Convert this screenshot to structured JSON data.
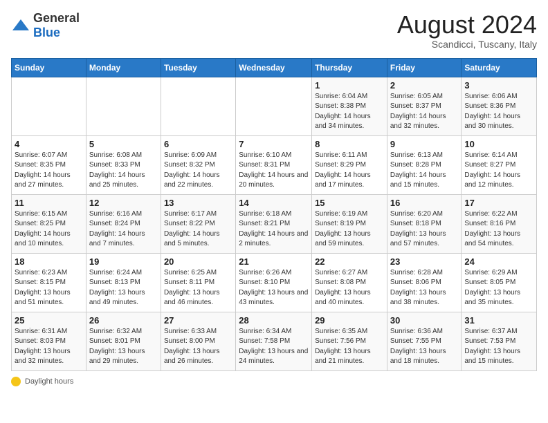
{
  "header": {
    "logo_general": "General",
    "logo_blue": "Blue",
    "month_year": "August 2024",
    "location": "Scandicci, Tuscany, Italy"
  },
  "days_of_week": [
    "Sunday",
    "Monday",
    "Tuesday",
    "Wednesday",
    "Thursday",
    "Friday",
    "Saturday"
  ],
  "weeks": [
    [
      {
        "day": "",
        "content": ""
      },
      {
        "day": "",
        "content": ""
      },
      {
        "day": "",
        "content": ""
      },
      {
        "day": "",
        "content": ""
      },
      {
        "day": "1",
        "content": "Sunrise: 6:04 AM\nSunset: 8:38 PM\nDaylight: 14 hours and 34 minutes."
      },
      {
        "day": "2",
        "content": "Sunrise: 6:05 AM\nSunset: 8:37 PM\nDaylight: 14 hours and 32 minutes."
      },
      {
        "day": "3",
        "content": "Sunrise: 6:06 AM\nSunset: 8:36 PM\nDaylight: 14 hours and 30 minutes."
      }
    ],
    [
      {
        "day": "4",
        "content": "Sunrise: 6:07 AM\nSunset: 8:35 PM\nDaylight: 14 hours and 27 minutes."
      },
      {
        "day": "5",
        "content": "Sunrise: 6:08 AM\nSunset: 8:33 PM\nDaylight: 14 hours and 25 minutes."
      },
      {
        "day": "6",
        "content": "Sunrise: 6:09 AM\nSunset: 8:32 PM\nDaylight: 14 hours and 22 minutes."
      },
      {
        "day": "7",
        "content": "Sunrise: 6:10 AM\nSunset: 8:31 PM\nDaylight: 14 hours and 20 minutes."
      },
      {
        "day": "8",
        "content": "Sunrise: 6:11 AM\nSunset: 8:29 PM\nDaylight: 14 hours and 17 minutes."
      },
      {
        "day": "9",
        "content": "Sunrise: 6:13 AM\nSunset: 8:28 PM\nDaylight: 14 hours and 15 minutes."
      },
      {
        "day": "10",
        "content": "Sunrise: 6:14 AM\nSunset: 8:27 PM\nDaylight: 14 hours and 12 minutes."
      }
    ],
    [
      {
        "day": "11",
        "content": "Sunrise: 6:15 AM\nSunset: 8:25 PM\nDaylight: 14 hours and 10 minutes."
      },
      {
        "day": "12",
        "content": "Sunrise: 6:16 AM\nSunset: 8:24 PM\nDaylight: 14 hours and 7 minutes."
      },
      {
        "day": "13",
        "content": "Sunrise: 6:17 AM\nSunset: 8:22 PM\nDaylight: 14 hours and 5 minutes."
      },
      {
        "day": "14",
        "content": "Sunrise: 6:18 AM\nSunset: 8:21 PM\nDaylight: 14 hours and 2 minutes."
      },
      {
        "day": "15",
        "content": "Sunrise: 6:19 AM\nSunset: 8:19 PM\nDaylight: 13 hours and 59 minutes."
      },
      {
        "day": "16",
        "content": "Sunrise: 6:20 AM\nSunset: 8:18 PM\nDaylight: 13 hours and 57 minutes."
      },
      {
        "day": "17",
        "content": "Sunrise: 6:22 AM\nSunset: 8:16 PM\nDaylight: 13 hours and 54 minutes."
      }
    ],
    [
      {
        "day": "18",
        "content": "Sunrise: 6:23 AM\nSunset: 8:15 PM\nDaylight: 13 hours and 51 minutes."
      },
      {
        "day": "19",
        "content": "Sunrise: 6:24 AM\nSunset: 8:13 PM\nDaylight: 13 hours and 49 minutes."
      },
      {
        "day": "20",
        "content": "Sunrise: 6:25 AM\nSunset: 8:11 PM\nDaylight: 13 hours and 46 minutes."
      },
      {
        "day": "21",
        "content": "Sunrise: 6:26 AM\nSunset: 8:10 PM\nDaylight: 13 hours and 43 minutes."
      },
      {
        "day": "22",
        "content": "Sunrise: 6:27 AM\nSunset: 8:08 PM\nDaylight: 13 hours and 40 minutes."
      },
      {
        "day": "23",
        "content": "Sunrise: 6:28 AM\nSunset: 8:06 PM\nDaylight: 13 hours and 38 minutes."
      },
      {
        "day": "24",
        "content": "Sunrise: 6:29 AM\nSunset: 8:05 PM\nDaylight: 13 hours and 35 minutes."
      }
    ],
    [
      {
        "day": "25",
        "content": "Sunrise: 6:31 AM\nSunset: 8:03 PM\nDaylight: 13 hours and 32 minutes."
      },
      {
        "day": "26",
        "content": "Sunrise: 6:32 AM\nSunset: 8:01 PM\nDaylight: 13 hours and 29 minutes."
      },
      {
        "day": "27",
        "content": "Sunrise: 6:33 AM\nSunset: 8:00 PM\nDaylight: 13 hours and 26 minutes."
      },
      {
        "day": "28",
        "content": "Sunrise: 6:34 AM\nSunset: 7:58 PM\nDaylight: 13 hours and 24 minutes."
      },
      {
        "day": "29",
        "content": "Sunrise: 6:35 AM\nSunset: 7:56 PM\nDaylight: 13 hours and 21 minutes."
      },
      {
        "day": "30",
        "content": "Sunrise: 6:36 AM\nSunset: 7:55 PM\nDaylight: 13 hours and 18 minutes."
      },
      {
        "day": "31",
        "content": "Sunrise: 6:37 AM\nSunset: 7:53 PM\nDaylight: 13 hours and 15 minutes."
      }
    ]
  ],
  "footer": {
    "daylight_hours_label": "Daylight hours"
  }
}
